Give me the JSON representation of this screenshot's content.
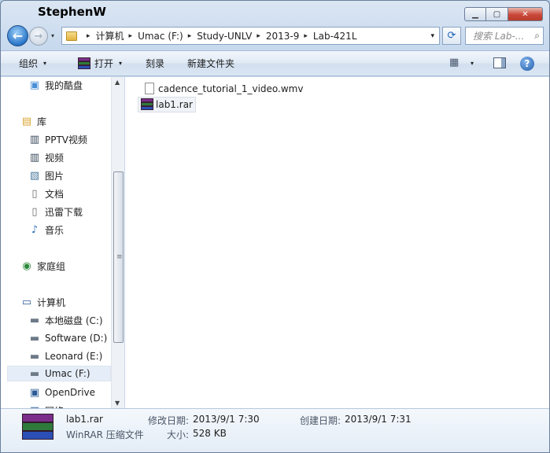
{
  "window": {
    "title": "StephenW",
    "min_glyph": "▁",
    "max_glyph": "▢",
    "close_glyph": "✕"
  },
  "nav": {
    "back_glyph": "←",
    "forward_glyph": "→",
    "dropdown_glyph": "▾"
  },
  "address": {
    "crumbs": [
      "计算机",
      "Umac (F:)",
      "Study-UNLV",
      "2013-9",
      "Lab-421L"
    ],
    "separator": "▸",
    "dropdown_glyph": "▾"
  },
  "refresh_glyph": "⟳",
  "search": {
    "placeholder": "搜索 Lab-...",
    "icon": "search-icon",
    "glyph": "⌕"
  },
  "toolbar": {
    "organize_label": "组织",
    "open_label": "打开",
    "burn_label": "刻录",
    "new_folder_label": "新建文件夹",
    "caret": "▾",
    "views_glyph": "▦",
    "help_glyph": "?"
  },
  "sidebar": {
    "items": [
      {
        "label": "我的酷盘",
        "icon": "cloud-drive-icon",
        "glyph": "▣"
      },
      {
        "label": "库",
        "icon": "libraries-icon",
        "glyph": "▤"
      },
      {
        "label": "PPTV视频",
        "icon": "video-library-icon",
        "glyph": "▥"
      },
      {
        "label": "视频",
        "icon": "video-icon",
        "glyph": "▥"
      },
      {
        "label": "图片",
        "icon": "pictures-icon",
        "glyph": "▧"
      },
      {
        "label": "文档",
        "icon": "documents-icon",
        "glyph": "▯"
      },
      {
        "label": "迅雷下载",
        "icon": "download-icon",
        "glyph": "▯"
      },
      {
        "label": "音乐",
        "icon": "music-icon",
        "glyph": "♪"
      },
      {
        "label": "家庭组",
        "icon": "homegroup-icon",
        "glyph": "◉"
      },
      {
        "label": "计算机",
        "icon": "computer-icon",
        "glyph": "▭"
      },
      {
        "label": "本地磁盘 (C:)",
        "icon": "local-disk-icon",
        "glyph": "▬"
      },
      {
        "label": "Software (D:)",
        "icon": "drive-icon",
        "glyph": "▬"
      },
      {
        "label": "Leonard (E:)",
        "icon": "drive-icon",
        "glyph": "▬"
      },
      {
        "label": "Umac (F:)",
        "icon": "drive-icon",
        "glyph": "▬"
      },
      {
        "label": "OpenDrive",
        "icon": "opendrive-icon",
        "glyph": "▣"
      },
      {
        "label": "网络",
        "icon": "network-icon",
        "glyph": "▦"
      }
    ],
    "scroll_up": "▲",
    "scroll_down": "▼",
    "scroll_grip": "≡"
  },
  "files": [
    {
      "name": "cadence_tutorial_1_video.wmv",
      "icon": "document-icon"
    },
    {
      "name": "lab1.rar",
      "icon": "winrar-icon"
    }
  ],
  "details": {
    "name": "lab1.rar",
    "type": "WinRAR 压缩文件",
    "modified_label": "修改日期:",
    "modified_value": "2013/9/1 7:30",
    "size_label": "大小:",
    "size_value": "528 KB",
    "created_label": "创建日期:",
    "created_value": "2013/9/1 7:31"
  },
  "colors": {
    "rar_stripes": [
      "#7a2d8a",
      "#2f7a3b",
      "#2b4fb5"
    ],
    "accent": "#1d63b8"
  }
}
